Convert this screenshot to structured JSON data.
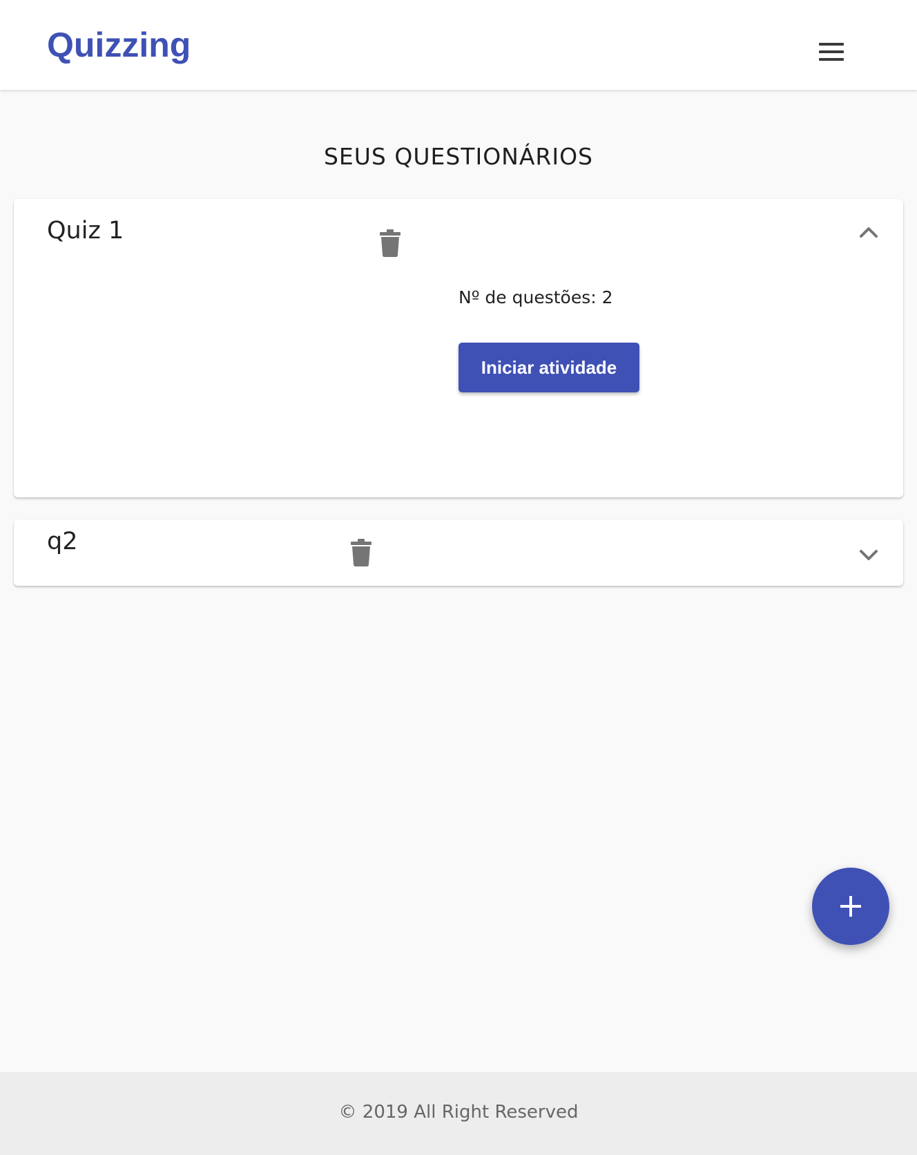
{
  "app": {
    "brand": "Quizzing",
    "accent_color": "#3f51b5",
    "menu_icon": "hamburger-menu-icon"
  },
  "main": {
    "title": "SEUS QUESTIONÁRIOS",
    "quizzes": [
      {
        "name": "Quiz 1",
        "expanded": true,
        "delete_icon": "trash-icon",
        "toggle_icon": "chevron-up-icon",
        "questions_text": "Nº de questões: 2",
        "start_label": "Iniciar atividade"
      },
      {
        "name": "q2",
        "expanded": false,
        "delete_icon": "trash-icon",
        "toggle_icon": "chevron-down-icon"
      }
    ],
    "add_icon": "plus-icon"
  },
  "footer": {
    "text": "© 2019 All Right Reserved"
  }
}
